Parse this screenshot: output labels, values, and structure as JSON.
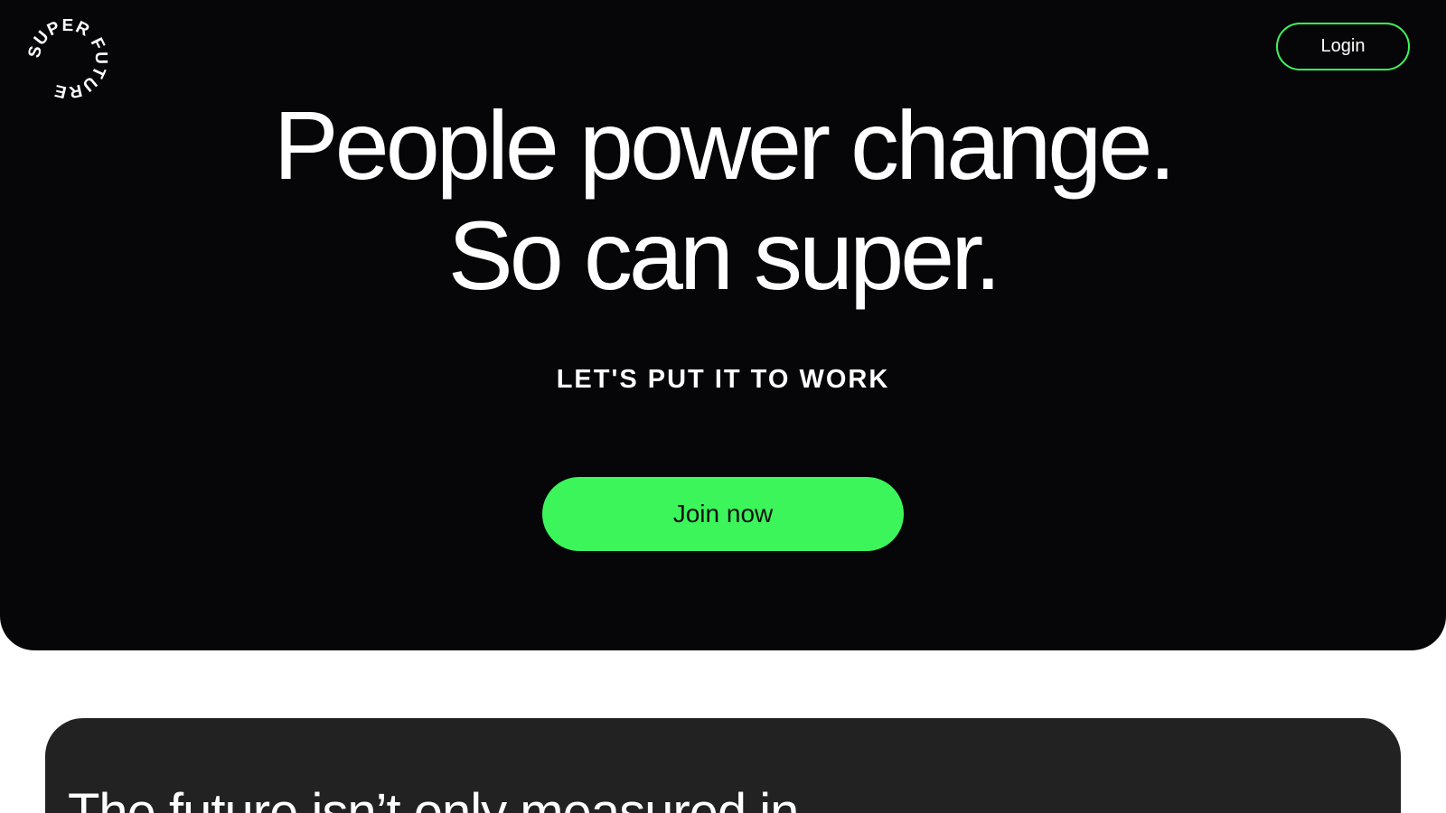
{
  "brand": {
    "logo_text": "SUPER FUTURE"
  },
  "header": {
    "login_label": "Login"
  },
  "hero": {
    "headline_line1": "People power change.",
    "headline_line2": "So can super.",
    "tagline": "LET'S PUT IT TO WORK",
    "cta_label": "Join now"
  },
  "section": {
    "heading": "The future isn’t only measured in"
  },
  "colors": {
    "accent": "#3bf55b",
    "hero_background": "#060508",
    "card_background": "#222222"
  }
}
